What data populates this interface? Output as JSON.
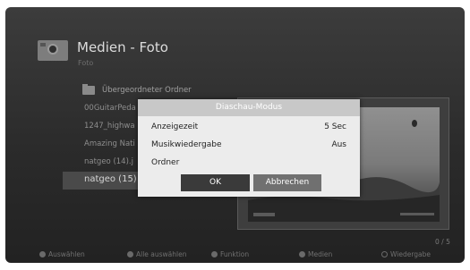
{
  "header": {
    "title": "Medien - Foto",
    "subtitle": "Foto",
    "icon": "camera-icon"
  },
  "file_list": {
    "items": [
      {
        "label": "Übergeordneter Ordner",
        "type": "parent-folder"
      },
      {
        "label": "00GuitarPeda",
        "type": "file"
      },
      {
        "label": "1247_highwa",
        "type": "file"
      },
      {
        "label": "Amazing Nati",
        "type": "file"
      },
      {
        "label": "natgeo (14).j",
        "type": "file"
      },
      {
        "label": "natgeo (15)",
        "type": "file",
        "selected": true
      }
    ]
  },
  "counter": "0 / 5",
  "bottom_hints": [
    {
      "label": "Auswählen",
      "icon": "button-dot-icon"
    },
    {
      "label": "Alle auswählen",
      "icon": "button-dot-icon"
    },
    {
      "label": "Funktion",
      "icon": "button-dot-icon"
    },
    {
      "label": "Medien",
      "icon": "button-dot-icon"
    },
    {
      "label": "Wiedergabe",
      "icon": "ok-button-icon"
    }
  ],
  "dialog": {
    "title": "Diaschau-Modus",
    "rows": [
      {
        "label": "Anzeigezeit",
        "value": "5 Sec"
      },
      {
        "label": "Musikwiedergabe",
        "value": "Aus"
      },
      {
        "label": "Ordner",
        "value": ""
      }
    ],
    "ok_label": "OK",
    "cancel_label": "Abbrechen"
  },
  "colors": {
    "background": "#2b2b2b",
    "dialog_bg": "#ececec",
    "dialog_title_bg": "#c8c8c8",
    "ok_button": "#3a3a3a",
    "cancel_button": "#707070"
  }
}
